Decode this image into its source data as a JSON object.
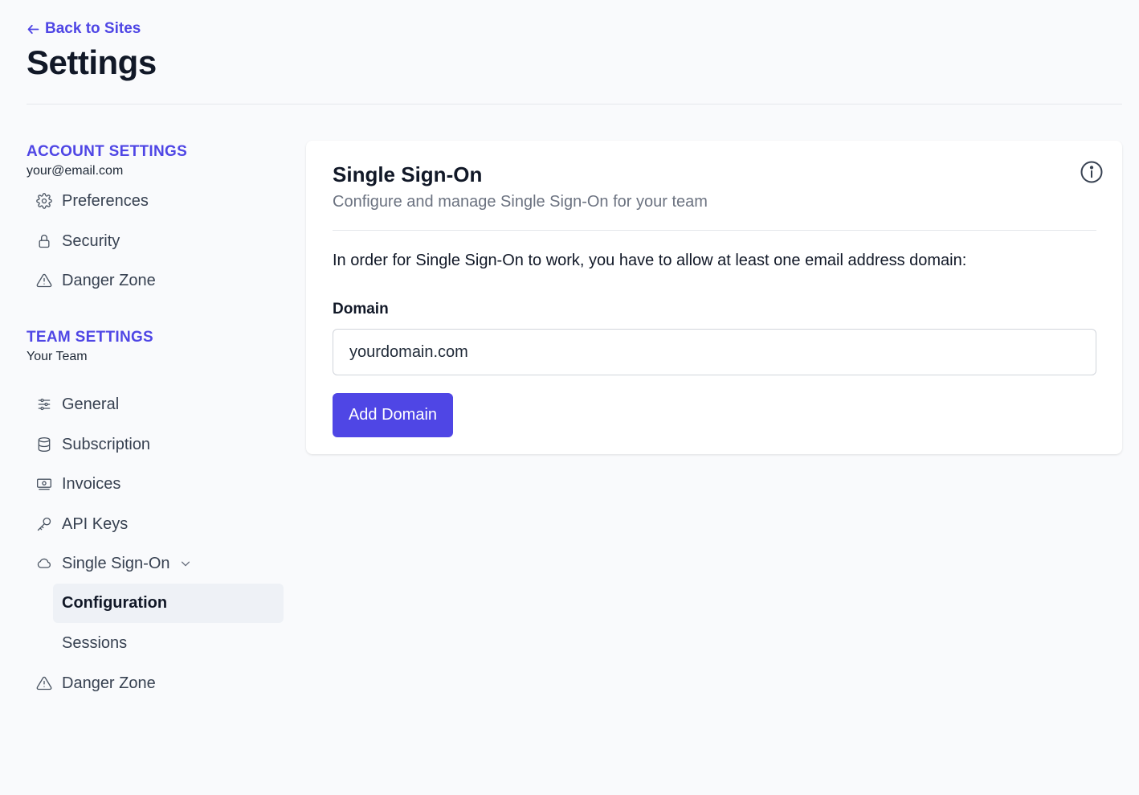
{
  "header": {
    "back_label": "Back to Sites",
    "title": "Settings"
  },
  "sidebar": {
    "account": {
      "heading": "ACCOUNT SETTINGS",
      "email": "your@email.com",
      "items": [
        {
          "label": "Preferences",
          "icon": "gear-icon"
        },
        {
          "label": "Security",
          "icon": "lock-icon"
        },
        {
          "label": "Danger Zone",
          "icon": "warning-icon"
        }
      ]
    },
    "team": {
      "heading": "TEAM SETTINGS",
      "name": "Your Team",
      "items": [
        {
          "label": "General",
          "icon": "sliders-icon"
        },
        {
          "label": "Subscription",
          "icon": "database-icon"
        },
        {
          "label": "Invoices",
          "icon": "banknote-icon"
        },
        {
          "label": "API Keys",
          "icon": "key-icon"
        },
        {
          "label": "Single Sign-On",
          "icon": "cloud-icon",
          "expanded": true
        },
        {
          "label": "Danger Zone",
          "icon": "warning-icon"
        }
      ],
      "sso_subitems": [
        {
          "label": "Configuration",
          "active": true
        },
        {
          "label": "Sessions",
          "active": false
        }
      ]
    }
  },
  "card": {
    "title": "Single Sign-On",
    "description": "Configure and manage Single Sign-On for your team",
    "instruction": "In order for Single Sign-On to work, you have to allow at least one email address domain:",
    "field_label": "Domain",
    "input_placeholder": "yourdomain.com",
    "input_value": "",
    "button_label": "Add Domain"
  },
  "colors": {
    "accent": "#4f46e5",
    "background": "#f9fafc",
    "active_item_bg": "#eef1f6"
  }
}
